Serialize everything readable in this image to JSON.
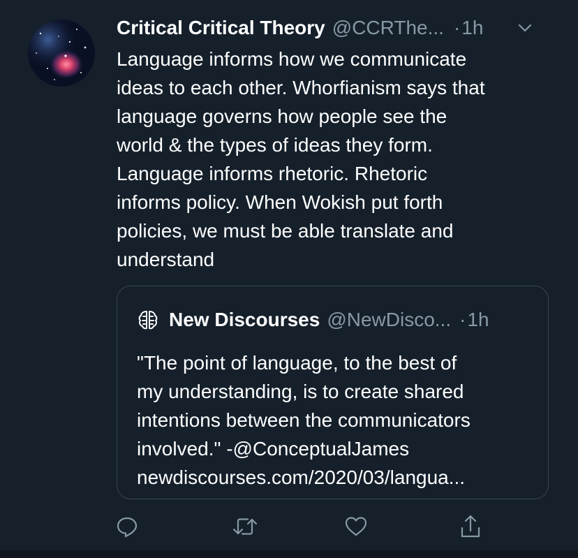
{
  "tweet": {
    "display_name": "Critical Critical Theory",
    "handle": "@CCRThe...",
    "separator": "·",
    "time": "1h",
    "text": "Language informs how we communicate\nideas to each other. Whorfianism says that\nlanguage governs how people see the\nworld & the types of ideas they form.\nLanguage informs rhetoric. Rhetoric\ninforms policy. When Wokish put forth\npolicies, we must be able translate and\nunderstand"
  },
  "quote": {
    "display_name": "New Discourses",
    "handle": "@NewDisco...",
    "separator": "·",
    "time": "1h",
    "text": "\"The point of language, to the best of\nmy understanding, is to create shared\nintentions between the communicators\ninvolved.\" -@ConceptualJames\nnewdiscourses.com/2020/03/langua..."
  },
  "icons": {
    "avatar": "nebula-avatar",
    "quote_avatar": "brain-logo-icon",
    "caret": "chevron-down-icon",
    "reply": "reply-icon",
    "retweet": "retweet-icon",
    "like": "heart-icon",
    "share": "share-icon"
  },
  "colors": {
    "background": "#15202b",
    "primary_text": "#ffffff",
    "secondary_text": "#8899a6",
    "border": "#38444d"
  }
}
